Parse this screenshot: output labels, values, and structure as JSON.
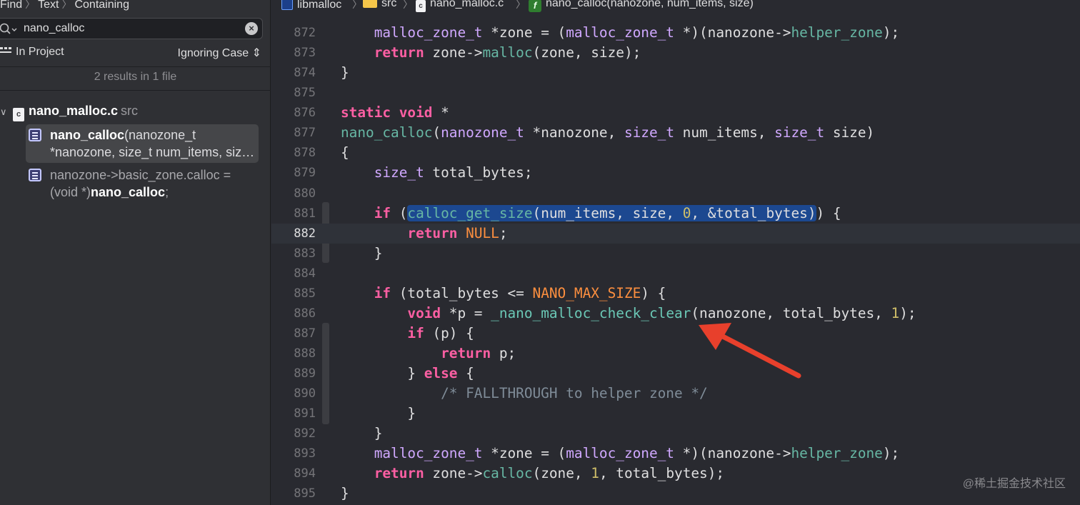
{
  "find": {
    "breadcrumb": [
      "Find",
      "Text",
      "Containing"
    ],
    "search_value": "nano_calloc",
    "scope": "In Project",
    "case_mode": "Ignoring Case",
    "results_summary": "2 results in 1 file"
  },
  "results": {
    "file": {
      "name": "nano_malloc.c",
      "dir": "src"
    },
    "matches": [
      {
        "hit": "nano_calloc",
        "rest": "(nanozone_t *nanozone, size_t num_items, siz…"
      },
      {
        "pre": "nanozone->basic_zone.calloc = (void *)",
        "hit": "nano_calloc",
        "post": ";"
      }
    ]
  },
  "jumpbar": [
    "libmalloc",
    "src",
    "nano_malloc.c",
    "nano_calloc(nanozone, num_items, size)"
  ],
  "editor": {
    "current_line": "882",
    "line_numbers": [
      "872",
      "873",
      "874",
      "875",
      "876",
      "877",
      "878",
      "879",
      "880",
      "881",
      "882",
      "883",
      "884",
      "885",
      "886",
      "887",
      "888",
      "889",
      "890",
      "891",
      "892",
      "893",
      "894",
      "895"
    ],
    "tokens": {
      "malloc_zone_t": "malloc_zone_t",
      "return": "return",
      "static": "static",
      "void": "void",
      "nano_calloc": "nano_calloc",
      "nanozone_t": "nanozone_t",
      "size_t": "size_t",
      "if": "if",
      "else": "else",
      "calloc_get_size": "calloc_get_size",
      "NULL": "NULL",
      "NANO_MAX_SIZE": "NANO_MAX_SIZE",
      "check_clear": "_nano_malloc_check_clear",
      "helper_zone": "helper_zone",
      "malloc": "malloc",
      "calloc": "calloc",
      "zero": "0",
      "one": "1",
      "comment": "/* FALLTHROUGH to helper zone */"
    }
  },
  "watermark": "@稀土掘金技术社区",
  "colors": {
    "background": "#292a30",
    "keyword": "#fc5fa3",
    "type": "#d0a8ff",
    "function": "#67b7a4",
    "number": "#d0bf69",
    "macro": "#fd8f3f",
    "comment": "#7f8c98",
    "selection": "#1c4890",
    "arrow": "#e8402c"
  }
}
